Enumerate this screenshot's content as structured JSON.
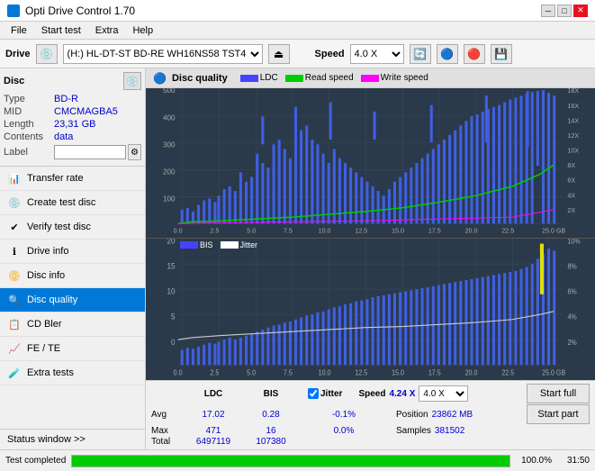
{
  "app": {
    "title": "Opti Drive Control 1.70",
    "icon": "disc-icon"
  },
  "titlebar": {
    "title": "Opti Drive Control 1.70",
    "minimize": "─",
    "maximize": "□",
    "close": "✕"
  },
  "menubar": {
    "items": [
      "File",
      "Start test",
      "Extra",
      "Help"
    ]
  },
  "toolbar": {
    "drive_label": "Drive",
    "drive_value": "(H:)  HL-DT-ST BD-RE  WH16NS58 TST4",
    "speed_label": "Speed",
    "speed_value": "4.0 X"
  },
  "disc_panel": {
    "title": "Disc",
    "type_label": "Type",
    "type_value": "BD-R",
    "mid_label": "MID",
    "mid_value": "CMCMAGBA5",
    "length_label": "Length",
    "length_value": "23,31 GB",
    "contents_label": "Contents",
    "contents_value": "data",
    "label_label": "Label",
    "label_value": ""
  },
  "nav": {
    "items": [
      {
        "id": "transfer-rate",
        "label": "Transfer rate",
        "icon": "📊"
      },
      {
        "id": "create-test-disc",
        "label": "Create test disc",
        "icon": "💿"
      },
      {
        "id": "verify-test-disc",
        "label": "Verify test disc",
        "icon": "✔"
      },
      {
        "id": "drive-info",
        "label": "Drive info",
        "icon": "ℹ"
      },
      {
        "id": "disc-info",
        "label": "Disc info",
        "icon": "📀"
      },
      {
        "id": "disc-quality",
        "label": "Disc quality",
        "icon": "🔍",
        "active": true
      },
      {
        "id": "cd-bler",
        "label": "CD Bler",
        "icon": "📋"
      },
      {
        "id": "fe-te",
        "label": "FE / TE",
        "icon": "📈"
      },
      {
        "id": "extra-tests",
        "label": "Extra tests",
        "icon": "🧪"
      }
    ],
    "status_window": "Status window >>"
  },
  "content": {
    "title": "Disc quality",
    "legend": [
      {
        "label": "LDC",
        "color": "#4444ff"
      },
      {
        "label": "Read speed",
        "color": "#00cc00"
      },
      {
        "label": "Write speed",
        "color": "#ff00ff"
      }
    ],
    "legend2": [
      {
        "label": "BIS",
        "color": "#4444ff"
      },
      {
        "label": "Jitter",
        "color": "#ffffff"
      }
    ],
    "chart1": {
      "y_max": 500,
      "y_min": 0,
      "x_max": 25.0,
      "y_right_labels": [
        "18X",
        "16X",
        "14X",
        "12X",
        "10X",
        "8X",
        "6X",
        "4X",
        "2X"
      ],
      "x_labels": [
        "0.0",
        "2.5",
        "5.0",
        "7.5",
        "10.0",
        "12.5",
        "15.0",
        "17.5",
        "20.0",
        "22.5",
        "25.0 GB"
      ]
    },
    "chart2": {
      "y_max": 20,
      "y_min": 0,
      "x_max": 25.0,
      "y_right_labels": [
        "10%",
        "8%",
        "6%",
        "4%",
        "2%"
      ],
      "x_labels": [
        "0.0",
        "2.5",
        "5.0",
        "7.5",
        "10.0",
        "12.5",
        "15.0",
        "17.5",
        "20.0",
        "22.5",
        "25.0 GB"
      ]
    }
  },
  "stats": {
    "ldc_label": "LDC",
    "bis_label": "BIS",
    "jitter_label": "Jitter",
    "speed_label": "Speed",
    "position_label": "Position",
    "samples_label": "Samples",
    "avg_label": "Avg",
    "max_label": "Max",
    "total_label": "Total",
    "ldc_avg": "17.02",
    "ldc_max": "471",
    "ldc_total": "6497119",
    "bis_avg": "0.28",
    "bis_max": "16",
    "bis_total": "107380",
    "jitter_avg": "-0.1%",
    "jitter_max": "0.0%",
    "speed_value": "4.24 X",
    "speed_select": "4.0 X",
    "position_value": "23862 MB",
    "samples_value": "381502",
    "start_full": "Start full",
    "start_part": "Start part"
  },
  "progress": {
    "percent": 100.0,
    "percent_text": "100.0%",
    "time_text": "31:50",
    "status_text": "Test completed"
  },
  "colors": {
    "active_nav": "#0078d7",
    "ldc_bar": "#4444ff",
    "read_speed_line": "#00cc00",
    "bis_bar": "#4444ff",
    "jitter_line": "#ffffff",
    "grid_bg": "#2a3a4a",
    "grid_line": "#3a4a5a",
    "progress_bar": "#00cc00"
  }
}
